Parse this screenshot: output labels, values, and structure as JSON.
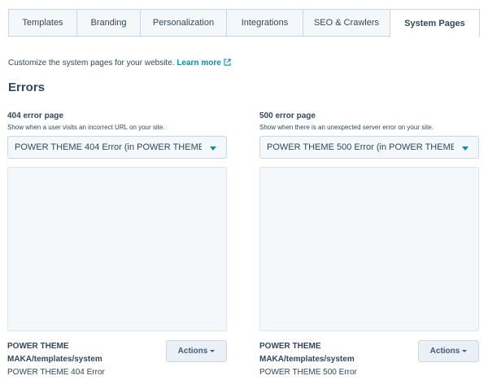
{
  "tabs": [
    "Templates",
    "Branding",
    "Personalization",
    "Integrations",
    "SEO & Crawlers",
    "System Pages"
  ],
  "intro": {
    "text": "Customize the system pages for your website. ",
    "link": "Learn more",
    "link_icon": "external-link-icon"
  },
  "section_title": "Errors",
  "columns": [
    {
      "label": "404 error page",
      "help": "Show when a user visits an incorrect URL on your site.",
      "selected": "POWER THEME 404 Error (in POWER THEME ...",
      "meta_title": "POWER THEME",
      "meta_path": "MAKA/templates/system",
      "meta_name": "POWER THEME 404 Error",
      "actions_label": "Actions"
    },
    {
      "label": "500 error page",
      "help": "Show when there is an unexpected server error on your site.",
      "selected": "POWER THEME 500 Error (in POWER THEME ...",
      "meta_title": "POWER THEME",
      "meta_path": "MAKA/templates/system",
      "meta_name": "POWER THEME 500 Error",
      "actions_label": "Actions"
    }
  ],
  "colors": {
    "accent": "#0091ae",
    "text": "#33475b",
    "border": "#cbd6e2",
    "panel": "#f5f8fa"
  }
}
